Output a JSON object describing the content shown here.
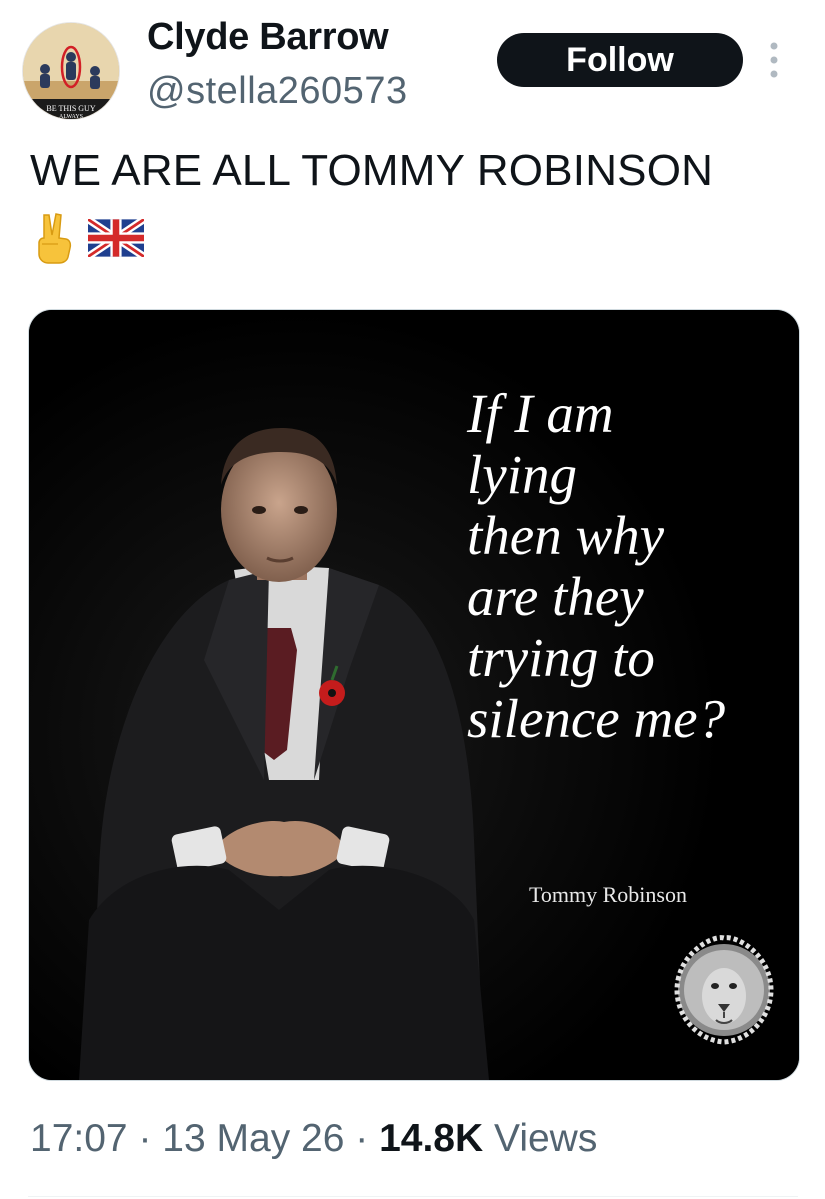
{
  "author": {
    "display_name": "Clyde Barrow",
    "handle": "@stella260573",
    "avatar_caption": "BE THIS GUY ALWAYS"
  },
  "actions": {
    "follow_label": "Follow",
    "more_icon": "more-vertical-icon"
  },
  "tweet": {
    "text": "WE ARE ALL TOMMY ROBINSON",
    "emojis": [
      "victory-hand",
      "union-jack-flag"
    ]
  },
  "media": {
    "quote_lines": [
      "If I am",
      "lying",
      "then why",
      "are they",
      "trying to",
      "silence me?"
    ],
    "attribution": "Tommy Robinson",
    "emblem_icon": "lion-head-icon",
    "background_color": "#000000"
  },
  "meta": {
    "time": "17:07",
    "separator": "·",
    "date": "13 May 26",
    "views_count": "14.8K",
    "views_label": "Views"
  },
  "colors": {
    "text_primary": "#0f1419",
    "text_secondary": "#536471",
    "follow_button_bg": "#0f1419",
    "follow_button_text": "#ffffff"
  }
}
